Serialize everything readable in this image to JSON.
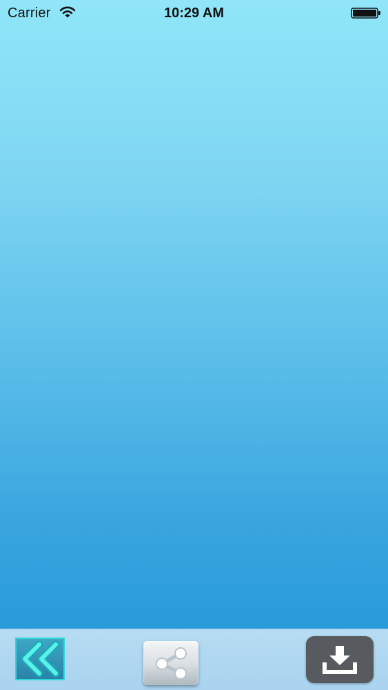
{
  "status_bar": {
    "carrier": "Carrier",
    "time": "10:29 AM",
    "wifi_icon": "wifi-icon",
    "battery_icon": "battery-icon",
    "battery_level": 1.0
  },
  "toolbar": {
    "back_icon": "double-chevron-left-icon",
    "share_icon": "share-icon",
    "download_icon": "download-icon"
  },
  "colors": {
    "background_top": "#90e6f8",
    "background_bottom": "#1f94d8",
    "toolbar": "#b0d8f1",
    "back_button_border": "#2fd6d8",
    "download_button": "#575b5f"
  }
}
